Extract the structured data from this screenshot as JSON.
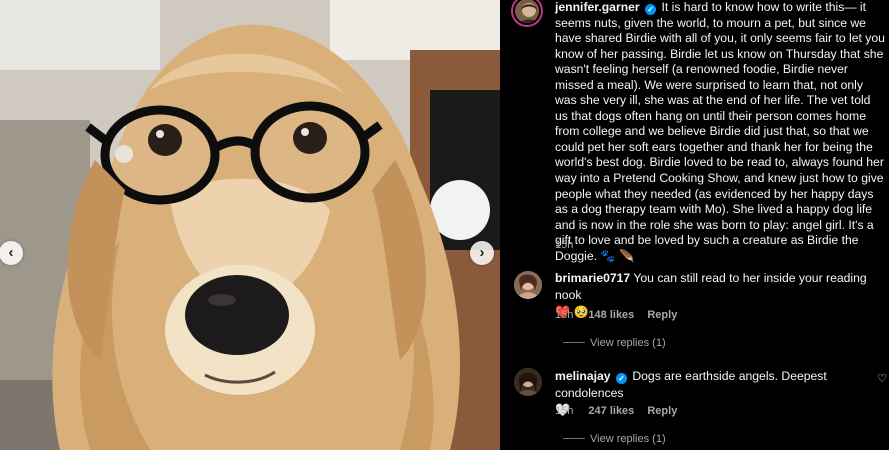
{
  "post": {
    "image_alt": "Golden retriever wearing black round glasses",
    "prev_label": "‹",
    "next_label": "›"
  },
  "caption": {
    "username": "jennifer.garner",
    "verified_mark": "✓",
    "text": "It is hard to know how to write this— it seems nuts, given the world, to mourn a pet, but since we have shared Birdie with all of you, it only seems fair to let you know of her passing. Birdie let us know on Thursday that she wasn't feeling herself (a renowned foodie, Birdie never missed a meal). We were surprised to learn that, not only was she very ill, she was at the end of her life. The vet told us that dogs often hang on until their person comes home from college and we believe Birdie did just that, so that we could pet her soft ears together and thank her for being the world's best dog. Birdie loved to be read to, always found her way into a Pretend Cooking Show, and knew just how to give people what they needed (as evidenced by her happy days as a dog therapy team with Mo). She lived a happy dog life and is now in the role she was born to play: angel girl. It's a gift to love and be loved by such a creature as Birdie the Doggie. 🐾 🪶",
    "time": "15h"
  },
  "comments": [
    {
      "username": "brimarie0717",
      "text": "You can still read to her inside your reading nook",
      "emojis": "❤️ 🥹",
      "time": "15h",
      "likes": "148 likes",
      "reply": "Reply",
      "view_replies": "View replies (1)"
    },
    {
      "username": "melinajay",
      "verified_mark": "✓",
      "text": "Dogs are earthside angels. Deepest condolences",
      "emojis": "🤍",
      "time": "15h",
      "likes": "247 likes",
      "reply": "Reply",
      "view_replies": "View replies (1)"
    }
  ],
  "icons": [
    "heart-icon",
    "chevron-left-icon",
    "chevron-right-icon",
    "verified-badge-icon"
  ]
}
